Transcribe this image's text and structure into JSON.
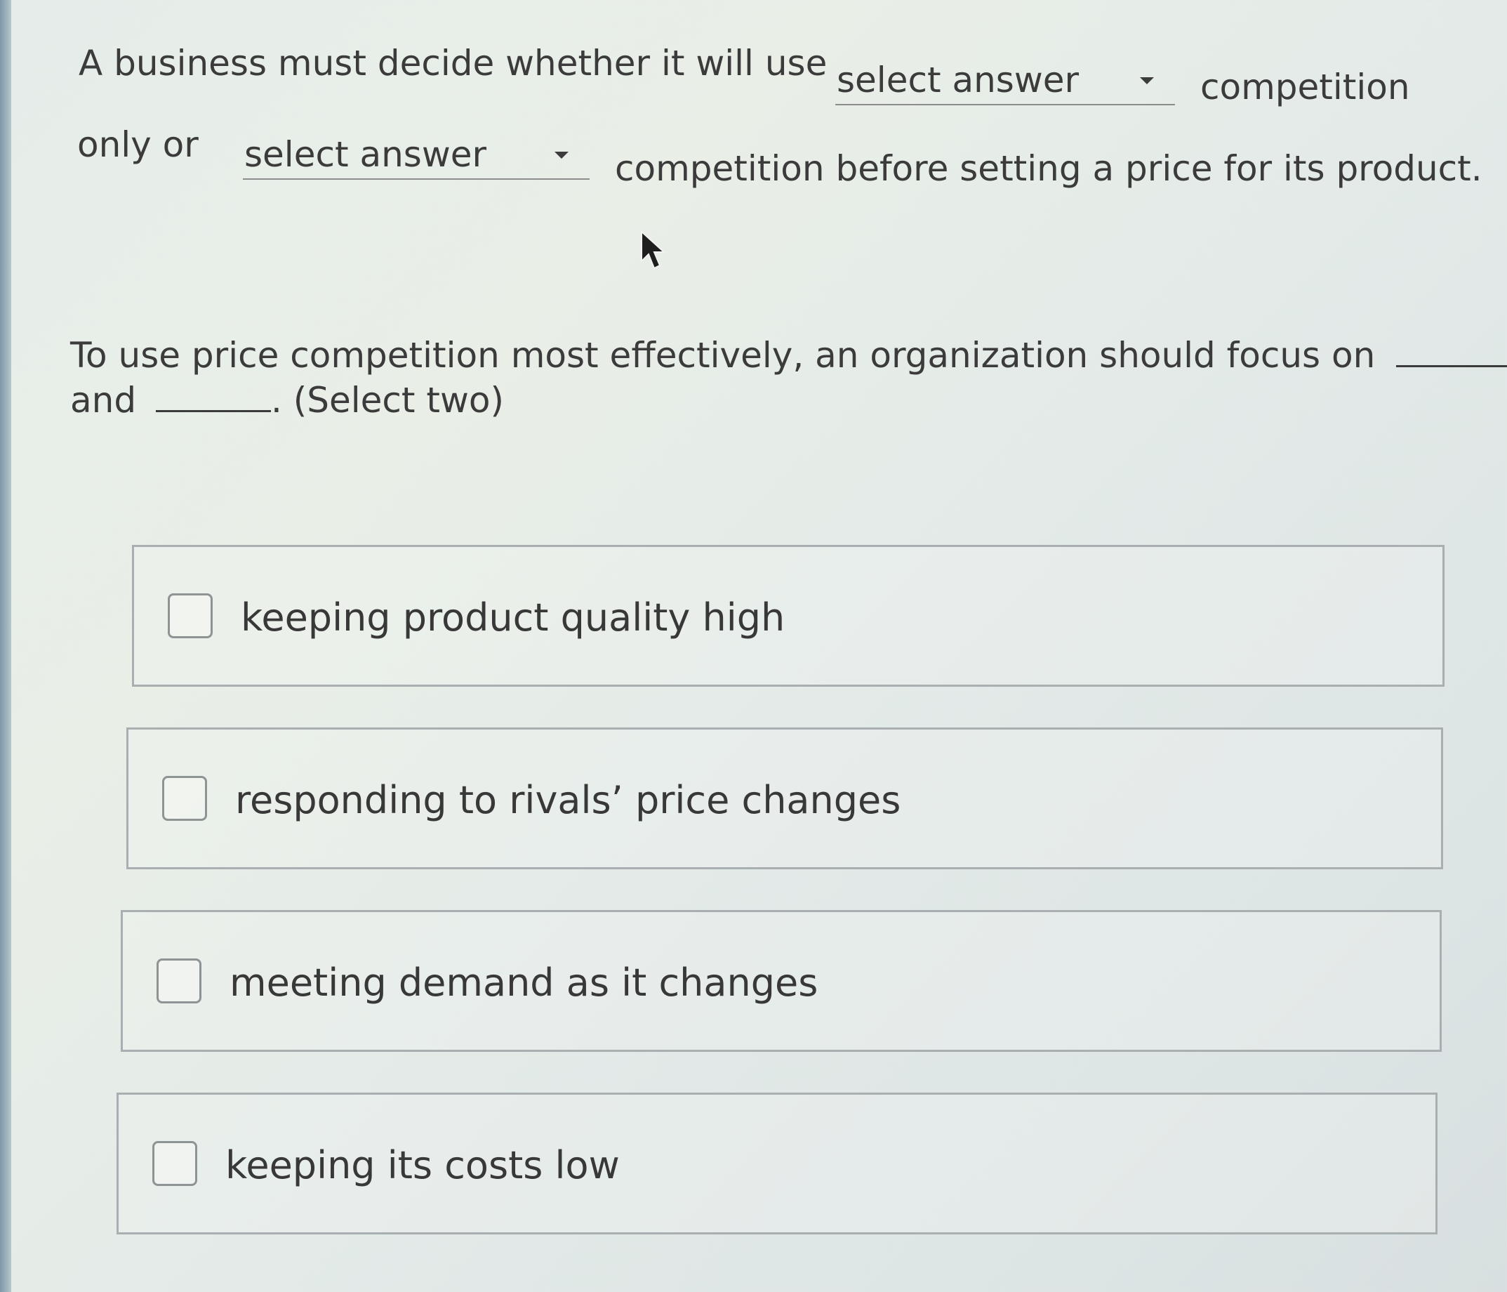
{
  "question1": {
    "text_1": "A business must decide whether it will use",
    "dropdown_1": "select answer",
    "text_2": "competition",
    "text_3": "only or",
    "dropdown_2": "select answer",
    "text_4": "competition before setting a price for its product."
  },
  "question2": {
    "line_1": "To use price competition most effectively, an organization should focus on",
    "line_2_a": "and",
    "line_2_b": ". (Select two)"
  },
  "options": [
    {
      "label": "keeping product quality high",
      "checked": false
    },
    {
      "label": "responding to rivals’ price changes",
      "checked": false
    },
    {
      "label": "meeting demand as it changes",
      "checked": false
    },
    {
      "label": "keeping its costs low",
      "checked": false
    }
  ],
  "icons": {
    "dropdown_caret": "caret-down-icon",
    "mouse_pointer": "mouse-pointer-icon"
  },
  "colors": {
    "text": "#3b3b3b",
    "option_border": "#a9aeb0",
    "checkbox_border": "#8e9394"
  }
}
